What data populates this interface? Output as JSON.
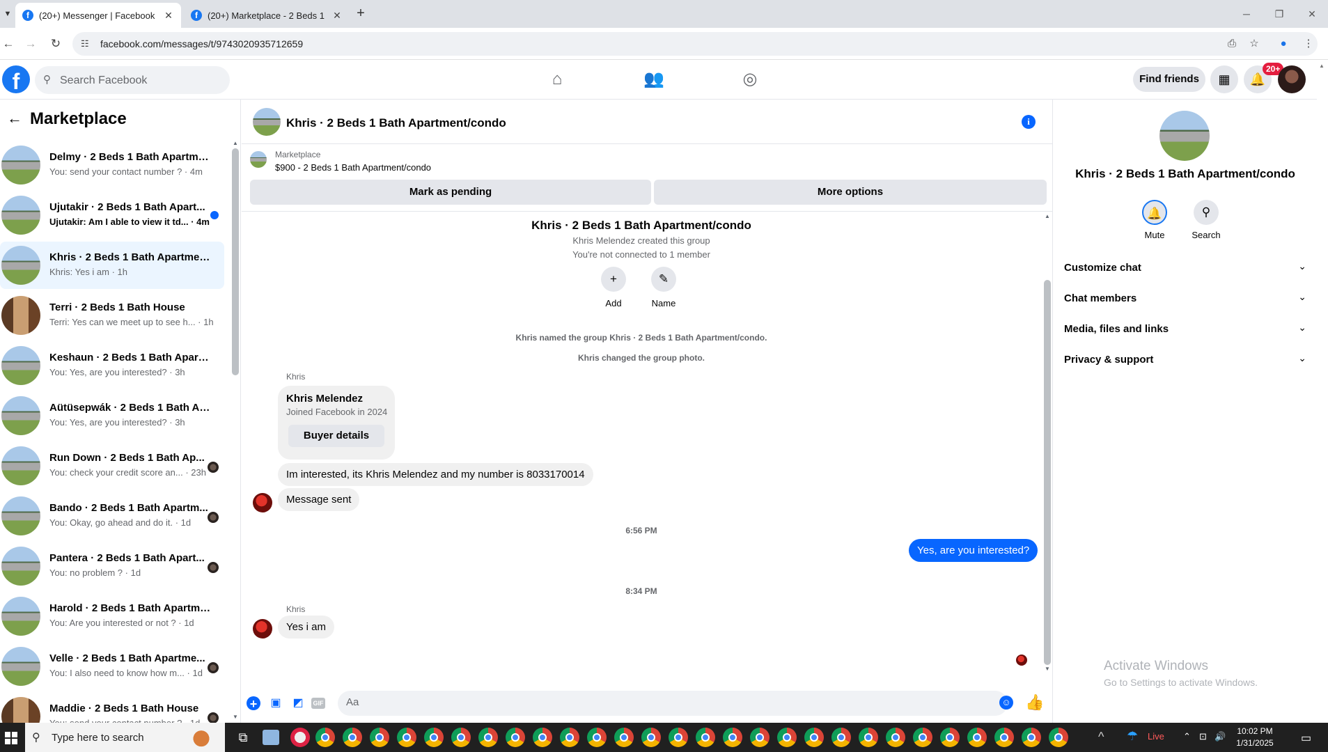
{
  "browser": {
    "tabs": [
      {
        "title": "(20+) Messenger | Facebook",
        "active": true
      },
      {
        "title": "(20+) Marketplace - 2 Beds 1 Ba",
        "active": false
      }
    ],
    "url": "facebook.com/messages/t/9743020935712659"
  },
  "fb": {
    "logo": "f",
    "search_placeholder": "Search Facebook",
    "find_friends": "Find friends",
    "notif_badge": "20+"
  },
  "sidebar": {
    "title": "Marketplace",
    "conversations": [
      {
        "name": "Delmy · 2 Beds 1 Bath Apartmen...",
        "snippet": "You: send your contact number ? · 4m",
        "thumb": "house",
        "unread": false,
        "indicator": "none"
      },
      {
        "name": "Ujutakir · 2 Beds 1 Bath Apart...",
        "snippet": "Ujutakir: Am I able to view it td... · 4m",
        "thumb": "house",
        "unread": true,
        "indicator": "dot"
      },
      {
        "name": "Khris · 2 Beds 1 Bath Apartment...",
        "snippet": "Khris: Yes i am · 1h",
        "thumb": "house",
        "unread": false,
        "indicator": "none",
        "selected": true
      },
      {
        "name": "Terri · 2 Beds 1 Bath House",
        "snippet": "Terri: Yes can we meet up to see h... · 1h",
        "thumb": "interior",
        "unread": false,
        "indicator": "none"
      },
      {
        "name": "Keshaun · 2 Beds 1 Bath Apartm...",
        "snippet": "You: Yes, are you interested? · 3h",
        "thumb": "house",
        "unread": false,
        "indicator": "none"
      },
      {
        "name": "Aütüsepwák · 2 Beds 1 Bath Apa...",
        "snippet": "You: Yes, are you interested? · 3h",
        "thumb": "house",
        "unread": false,
        "indicator": "none"
      },
      {
        "name": "Run Down · 2 Beds 1 Bath Ap...",
        "snippet": "You: check your credit score an... · 23h",
        "thumb": "house",
        "unread": false,
        "indicator": "seen"
      },
      {
        "name": "Bando · 2 Beds 1 Bath Apartm...",
        "snippet": "You: Okay, go ahead and do it. · 1d",
        "thumb": "house",
        "unread": false,
        "indicator": "seen"
      },
      {
        "name": "Pantera · 2 Beds 1 Bath Apart...",
        "snippet": "You: no problem ? · 1d",
        "thumb": "house",
        "unread": false,
        "indicator": "seen"
      },
      {
        "name": "Harold · 2 Beds 1 Bath Apartme...",
        "snippet": "You: Are you interested or not ? · 1d",
        "thumb": "house",
        "unread": false,
        "indicator": "none"
      },
      {
        "name": "Velle · 2 Beds 1 Bath Apartme...",
        "snippet": "You: I also need to know how m... · 1d",
        "thumb": "house",
        "unread": false,
        "indicator": "seen"
      },
      {
        "name": "Maddie · 2 Beds 1 Bath House",
        "snippet": "You: send your contact number ? · 1d",
        "thumb": "interior",
        "unread": false,
        "indicator": "seen"
      }
    ]
  },
  "chat": {
    "title": "Khris · 2 Beds 1 Bath Apartment/condo",
    "listing_kind": "Marketplace",
    "listing_desc": "$900 - 2 Beds 1 Bath Apartment/condo",
    "mark_pending": "Mark as pending",
    "more_options": "More options",
    "group_title": "Khris · 2 Beds 1 Bath Apartment/condo",
    "created": "Khris Melendez created this group",
    "not_connected": "You're not connected to 1 member",
    "add_label": "Add",
    "name_label": "Name",
    "sys1": "Khris named the group Khris · 2 Beds 1 Bath Apartment/condo.",
    "sys2": "Khris changed the group photo.",
    "sender1": "Khris",
    "profile_name": "Khris Melendez",
    "profile_joined": "Joined Facebook in 2024",
    "buyer_details": "Buyer details",
    "msg1": "Im interested, its Khris Melendez and my number is 8033170014",
    "msg2": "Message sent",
    "time1": "6:56 PM",
    "my_msg": "Yes, are you interested?",
    "time2": "8:34 PM",
    "sender2": "Khris",
    "msg3": "Yes i am",
    "composer_placeholder": "Aa",
    "gif_label": "GIF"
  },
  "details": {
    "name": "Khris · 2 Beds 1 Bath Apartment/condo",
    "mute": "Mute",
    "search": "Search",
    "rows": [
      "Customize chat",
      "Chat members",
      "Media, files and links",
      "Privacy & support"
    ]
  },
  "watermark": {
    "line1": "Activate Windows",
    "line2": "Go to Settings to activate Windows."
  },
  "taskbar": {
    "search_placeholder": "Type here to search",
    "weather": "Live",
    "time": "10:02 PM",
    "date": "1/31/2025"
  },
  "icons": {
    "home": "home-icon",
    "friends": "friends-icon",
    "groups": "groups-icon",
    "menu": "menu-grid-icon",
    "bell": "bell-icon",
    "info": "info-icon"
  },
  "colors": {
    "accent": "#0866ff",
    "fb_blue": "#1877f2",
    "badge": "#e41e3f",
    "selected_row": "#ebf5ff"
  }
}
